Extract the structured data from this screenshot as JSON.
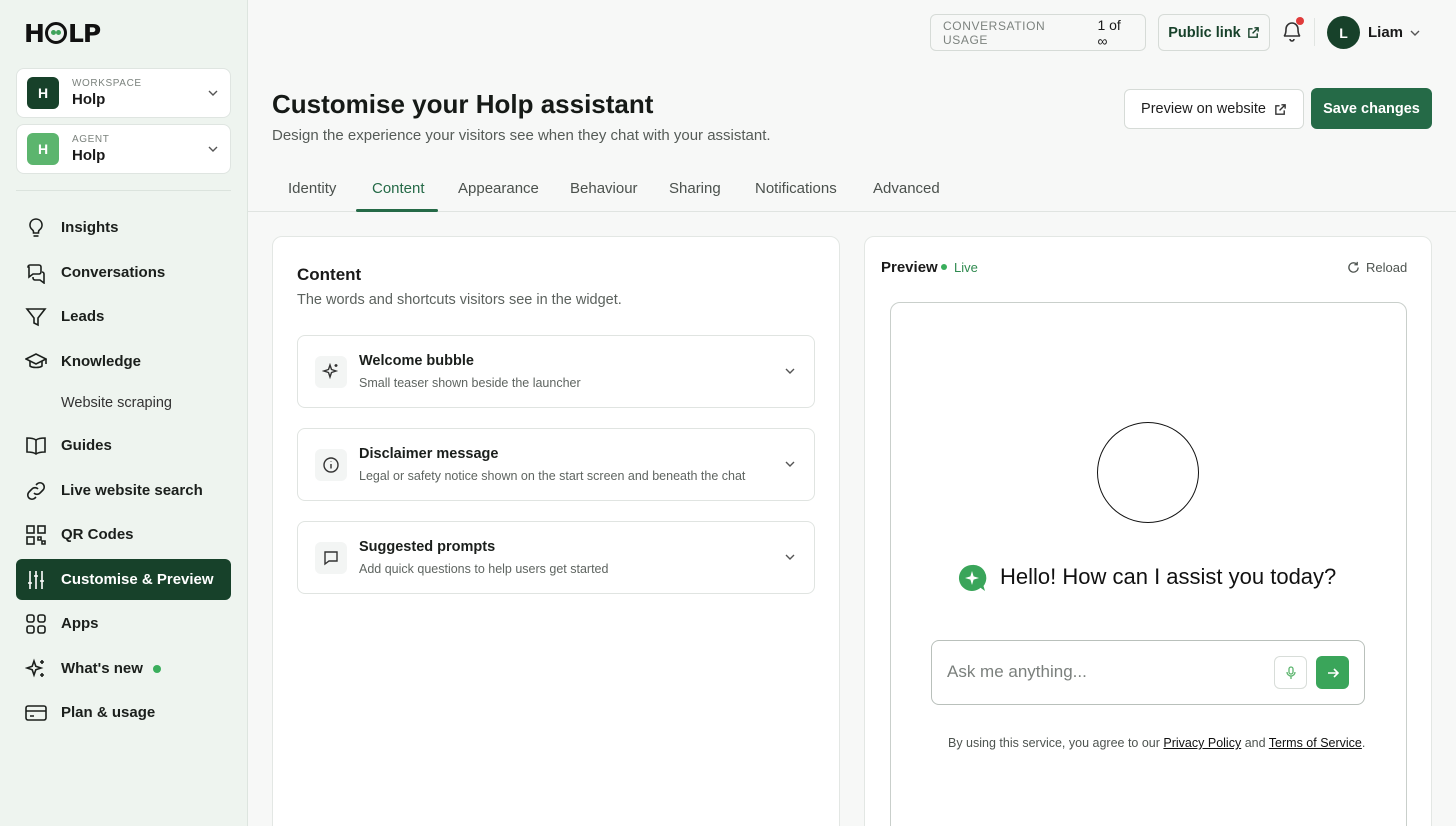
{
  "brand": {
    "logo_letters": [
      "H",
      "L",
      "P"
    ]
  },
  "workspace": {
    "label": "WORKSPACE",
    "name": "Holp",
    "badge": "H",
    "badge_color": "#17412a"
  },
  "agent": {
    "label": "AGENT",
    "name": "Holp",
    "badge": "H",
    "badge_color": "#5cb56e"
  },
  "nav": {
    "insights": "Insights",
    "conversations": "Conversations",
    "leads": "Leads",
    "knowledge": "Knowledge",
    "website_scraping": "Website scraping",
    "guides": "Guides",
    "live_search": "Live website search",
    "qr_codes": "QR Codes",
    "customise": "Customise & Preview",
    "apps": "Apps",
    "whats_new": "What's new",
    "plan": "Plan & usage"
  },
  "topbar": {
    "usage_label": "CONVERSATION USAGE",
    "usage_value": "1 of ∞",
    "public_link": "Public link",
    "user_initial": "L",
    "user_name": "Liam"
  },
  "header": {
    "title": "Customise your Holp assistant",
    "subtitle": "Design the experience your visitors see when they chat with your assistant.",
    "preview_button": "Preview on website",
    "save_button": "Save changes"
  },
  "tabs": [
    "Identity",
    "Content",
    "Appearance",
    "Behaviour",
    "Sharing",
    "Notifications",
    "Advanced"
  ],
  "active_tab": "Content",
  "content": {
    "title": "Content",
    "subtitle": "The words and shortcuts visitors see in the widget.",
    "sections": [
      {
        "title": "Welcome bubble",
        "desc": "Small teaser shown beside the launcher",
        "icon": "sparkle-icon"
      },
      {
        "title": "Disclaimer message",
        "desc": "Legal or safety notice shown on the start screen and beneath the chat",
        "icon": "info-icon"
      },
      {
        "title": "Suggested prompts",
        "desc": "Add quick questions to help users get started",
        "icon": "chat-bubble-icon"
      }
    ]
  },
  "preview": {
    "title": "Preview",
    "status": "Live",
    "reload": "Reload",
    "greeting": "Hello! How can I assist you today?",
    "input_placeholder": "Ask me anything...",
    "legal_prefix": "By using this service, you agree to our",
    "privacy": "Privacy Policy",
    "and": "and",
    "terms": "Terms of Service",
    "legal_suffix": "."
  },
  "colors": {
    "accent": "#256a47",
    "dark": "#17412a",
    "live": "#3aae5c",
    "notification": "#e03b3b"
  }
}
